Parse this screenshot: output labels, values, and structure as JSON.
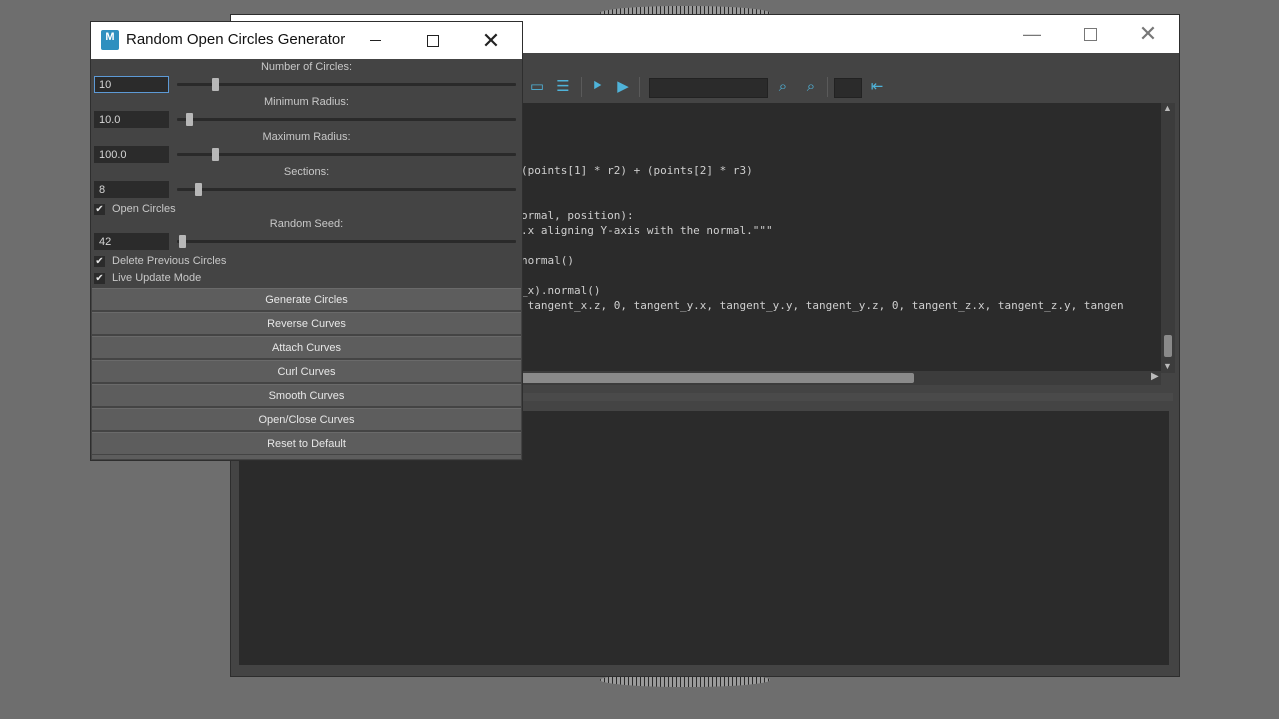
{
  "front_window": {
    "title": "Random Open Circles Generator",
    "logo_text": "M",
    "controls": [
      "minimize-icon",
      "maximize-icon",
      "close-icon"
    ],
    "fields": {
      "num_circles": {
        "label": "Number of Circles:",
        "value": "10",
        "slider_fraction": 0.1
      },
      "min_radius": {
        "label": "Minimum Radius:",
        "value": "10.0",
        "slider_fraction": 0.02
      },
      "max_radius": {
        "label": "Maximum Radius:",
        "value": "100.0",
        "slider_fraction": 0.1
      },
      "sections": {
        "label": "Sections:",
        "value": "8",
        "slider_fraction": 0.05
      },
      "random_seed": {
        "label": "Random Seed:",
        "value": "42",
        "slider_fraction": 0.0
      }
    },
    "checkboxes": {
      "open_circles": {
        "label": "Open Circles",
        "checked": true
      },
      "delete_previous": {
        "label": "Delete Previous Circles",
        "checked": true
      },
      "live_update": {
        "label": "Live Update Mode",
        "checked": true
      }
    },
    "check_glyph": "✔",
    "buttons": {
      "generate": "Generate Circles",
      "reverse": "Reverse Curves",
      "attach": "Attach Curves",
      "curl": "Curl Curves",
      "smooth": "Smooth Curves",
      "open_close": "Open/Close Curves",
      "reset": "Reset to Default"
    }
  },
  "back_window": {
    "code_lines": [
      "(points[1] * r2) + (points[2] * r3)",
      "ormal, position):",
      ".x aligning Y-axis with the normal.\"\"\"",
      "normal()",
      "_x).normal()",
      " tangent_x.z, 0, tangent_y.x, tangent_y.y, tangent_y.z, 0, tangent_z.x, tangent_z.y, tangen"
    ],
    "colors": {
      "accent_icon": "#4fb3d9",
      "panel": "#444444",
      "code_bg": "#2b2b2b"
    }
  }
}
